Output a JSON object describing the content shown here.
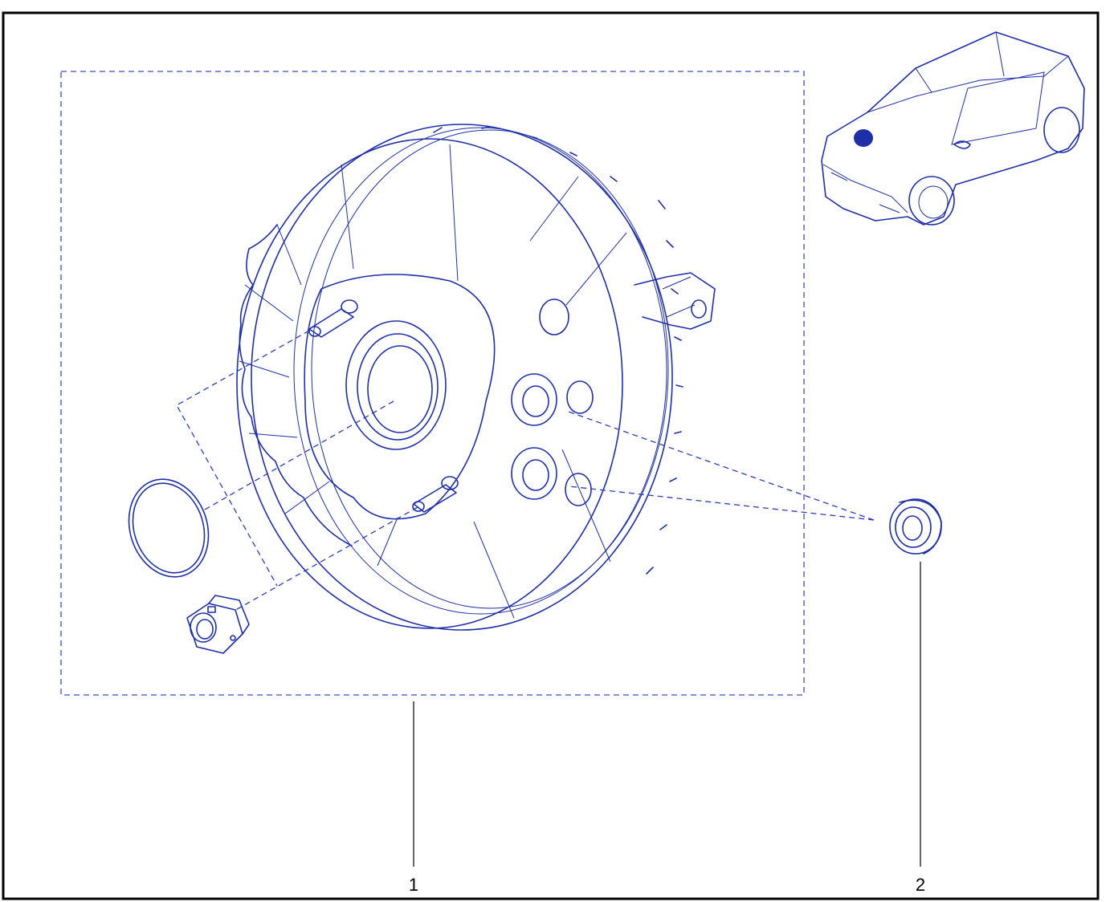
{
  "diagram": {
    "callouts": [
      {
        "label": "1"
      },
      {
        "label": "2"
      }
    ],
    "colors": {
      "line": "#1f2fa8",
      "frame": "#000000",
      "background": "#ffffff"
    },
    "icons": [
      "brake-booster-illustration",
      "o-ring-seal-illustration",
      "hex-nut-illustration",
      "grommet-illustration",
      "car-location-icon"
    ]
  }
}
